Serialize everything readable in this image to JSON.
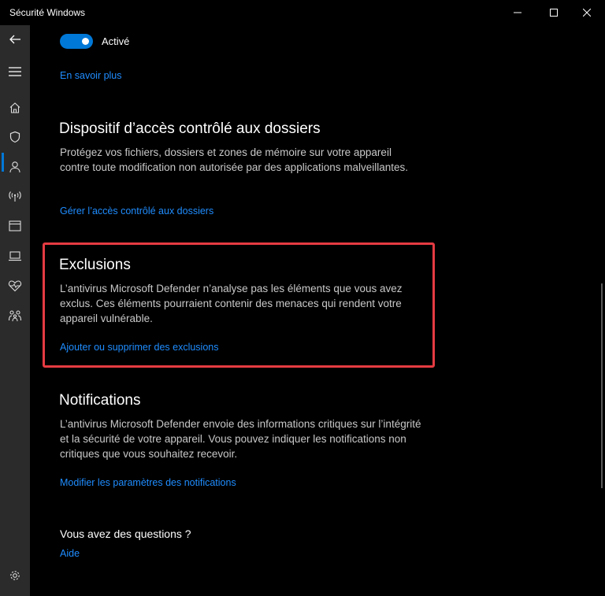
{
  "window": {
    "title": "Sécurité Windows",
    "controls": {
      "minimize": "minimize-icon",
      "maximize": "maximize-icon",
      "close": "close-icon"
    }
  },
  "sidebar": {
    "items": [
      {
        "icon": "back-arrow-icon"
      },
      {
        "icon": "hamburger-menu-icon"
      },
      {
        "icon": "home-icon"
      },
      {
        "icon": "shield-icon",
        "active": true
      },
      {
        "icon": "person-icon"
      },
      {
        "icon": "wifi-antenna-icon"
      },
      {
        "icon": "app-browser-icon"
      },
      {
        "icon": "laptop-icon"
      },
      {
        "icon": "heart-icon"
      },
      {
        "icon": "family-icon"
      },
      {
        "icon": "gear-icon"
      }
    ]
  },
  "top_toggle": {
    "label": "Activé",
    "state": "on"
  },
  "top_link": "En savoir plus",
  "sections": {
    "controlled_folder": {
      "title": "Dispositif d’accès contrôlé aux dossiers",
      "description": "Protégez vos fichiers, dossiers et zones de mémoire sur votre appareil contre toute modification non autorisée par des applications malveillantes.",
      "link": "Gérer l’accès contrôlé aux dossiers"
    },
    "exclusions": {
      "title": "Exclusions",
      "description": "L’antivirus Microsoft Defender n’analyse pas les éléments que vous avez exclus. Ces éléments pourraient contenir des menaces qui rendent votre appareil vulnérable.",
      "link": "Ajouter ou supprimer des exclusions"
    },
    "notifications": {
      "title": "Notifications",
      "description": "L’antivirus Microsoft Defender envoie des informations critiques sur l’intégrité et la sécurité de votre appareil. Vous pouvez indiquer les notifications non critiques que vous souhaitez recevoir.",
      "link": "Modifier les paramètres des notifications"
    }
  },
  "questions": {
    "title": "Vous avez des questions ?",
    "link": "Aide"
  },
  "colors": {
    "accent": "#0078d7",
    "link": "#1f8dff",
    "highlight": "#e53b42",
    "sidebar": "#2b2b2b",
    "background": "#000000"
  }
}
